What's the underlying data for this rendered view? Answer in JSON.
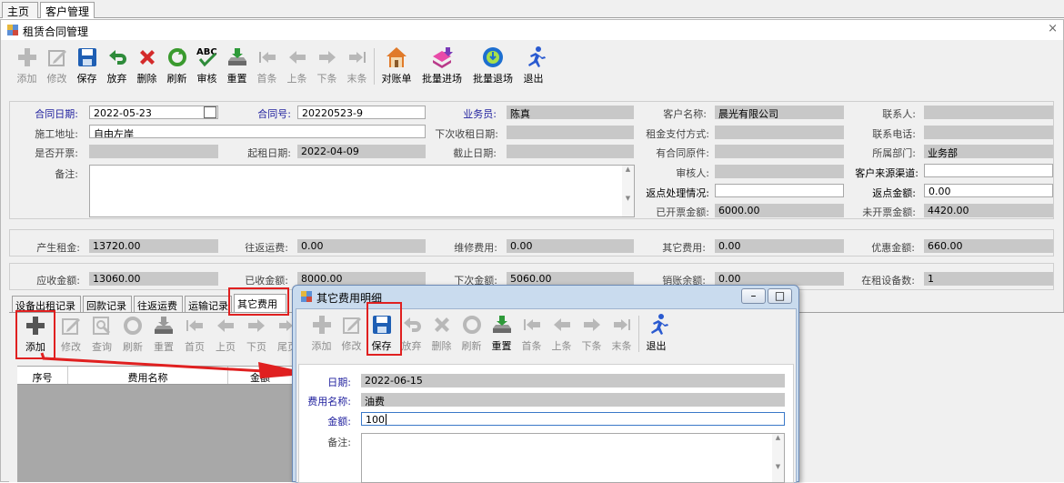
{
  "top_tabs": [
    "主页",
    "客户管理"
  ],
  "window": {
    "title": "租赁合同管理",
    "close": "×"
  },
  "toolbar": [
    {
      "label": "添加",
      "icon": "add-icon",
      "enabled": false
    },
    {
      "label": "修改",
      "icon": "edit-icon",
      "enabled": false
    },
    {
      "label": "保存",
      "icon": "save-icon",
      "enabled": true
    },
    {
      "label": "放弃",
      "icon": "undo-icon",
      "enabled": true
    },
    {
      "label": "删除",
      "icon": "delete-icon",
      "enabled": true
    },
    {
      "label": "刷新",
      "icon": "refresh-icon",
      "enabled": true
    },
    {
      "label": "审核",
      "icon": "spellcheck-icon",
      "enabled": true
    },
    {
      "label": "重置",
      "icon": "reset-icon",
      "enabled": true
    },
    {
      "label": "首条",
      "icon": "first-icon",
      "enabled": false
    },
    {
      "label": "上条",
      "icon": "prev-icon",
      "enabled": false
    },
    {
      "label": "下条",
      "icon": "next-icon",
      "enabled": false
    },
    {
      "label": "末条",
      "icon": "last-icon",
      "enabled": false
    },
    {
      "label": "对账单",
      "icon": "house-icon",
      "enabled": true
    },
    {
      "label": "批量进场",
      "icon": "import-icon",
      "enabled": true
    },
    {
      "label": "批量退场",
      "icon": "export-icon",
      "enabled": true
    },
    {
      "label": "退出",
      "icon": "exit-icon",
      "enabled": true
    }
  ],
  "form": {
    "contract_date": {
      "label": "合同日期:",
      "value": "2022-05-23"
    },
    "contract_no": {
      "label": "合同号:",
      "value": "20220523-9"
    },
    "salesman": {
      "label": "业务员:",
      "value": "陈真"
    },
    "customer": {
      "label": "客户名称:",
      "value": "晨光有限公司"
    },
    "contact": {
      "label": "联系人:",
      "value": ""
    },
    "site": {
      "label": "施工地址:",
      "value": "自由左岸"
    },
    "next_date": {
      "label": "下次收租日期:",
      "value": ""
    },
    "pay_method": {
      "label": "租金支付方式:",
      "value": ""
    },
    "phone": {
      "label": "联系电话:",
      "value": ""
    },
    "invoice": {
      "label": "是否开票:",
      "value": ""
    },
    "start_date": {
      "label": "起租日期:",
      "value": "2022-04-09"
    },
    "end_date": {
      "label": "截止日期:",
      "value": ""
    },
    "original": {
      "label": "有合同原件:",
      "value": ""
    },
    "dept": {
      "label": "所属部门:",
      "value": "业务部"
    },
    "remark": {
      "label": "备注:",
      "value": ""
    },
    "auditor": {
      "label": "审核人:",
      "value": ""
    },
    "source": {
      "label": "客户来源渠道:",
      "value": ""
    },
    "rebate_status": {
      "label": "返点处理情况:",
      "value": ""
    },
    "rebate_amount": {
      "label": "返点金额:",
      "value": "0.00"
    },
    "invoiced": {
      "label": "已开票金额:",
      "value": "6000.00"
    },
    "not_invoiced": {
      "label": "未开票金额:",
      "value": "4420.00"
    }
  },
  "summary1": [
    {
      "label": "产生租金:",
      "value": "13720.00"
    },
    {
      "label": "往返运费:",
      "value": "0.00"
    },
    {
      "label": "维修费用:",
      "value": "0.00"
    },
    {
      "label": "其它费用:",
      "value": "0.00"
    },
    {
      "label": "优惠金额:",
      "value": "660.00"
    }
  ],
  "summary2": [
    {
      "label": "应收金额:",
      "value": "13060.00"
    },
    {
      "label": "已收金额:",
      "value": "8000.00"
    },
    {
      "label": "下次金额:",
      "value": "5060.00"
    },
    {
      "label": "销账余额:",
      "value": "0.00"
    },
    {
      "label": "在租设备数:",
      "value": "1"
    }
  ],
  "subtabs": [
    "设备出租记录",
    "回款记录",
    "往返运费",
    "运输记录",
    "其它费用"
  ],
  "sub_toolbar": [
    "添加",
    "修改",
    "查询",
    "刷新",
    "重置",
    "首页",
    "上页",
    "下页",
    "尾页"
  ],
  "grid_headers": [
    "序号",
    "费用名称",
    "金额"
  ],
  "dialog": {
    "title": "其它费用明细",
    "toolbar": [
      {
        "label": "添加",
        "icon": "add-icon",
        "enabled": false
      },
      {
        "label": "修改",
        "icon": "edit-icon",
        "enabled": false
      },
      {
        "label": "保存",
        "icon": "save-icon",
        "enabled": true
      },
      {
        "label": "放弃",
        "icon": "undo-icon",
        "enabled": false
      },
      {
        "label": "删除",
        "icon": "delete-icon",
        "enabled": false
      },
      {
        "label": "刷新",
        "icon": "refresh-icon",
        "enabled": false
      },
      {
        "label": "重置",
        "icon": "reset-icon",
        "enabled": true
      },
      {
        "label": "首条",
        "icon": "first-icon",
        "enabled": false
      },
      {
        "label": "上条",
        "icon": "prev-icon",
        "enabled": false
      },
      {
        "label": "下条",
        "icon": "next-icon",
        "enabled": false
      },
      {
        "label": "末条",
        "icon": "last-icon",
        "enabled": false
      },
      {
        "label": "退出",
        "icon": "exit-icon",
        "enabled": true
      }
    ],
    "date": {
      "label": "日期:",
      "value": "2022-06-15"
    },
    "fee_name": {
      "label": "费用名称:",
      "value": "油费"
    },
    "amount": {
      "label": "金额:",
      "value": "100"
    },
    "remark": {
      "label": "备注:",
      "value": ""
    }
  },
  "colors": {
    "highlight": "#e02020",
    "readonly": "#c8c8c8",
    "label_blue": "#1f1f9e",
    "dialog_bg": "#c9dbee"
  }
}
